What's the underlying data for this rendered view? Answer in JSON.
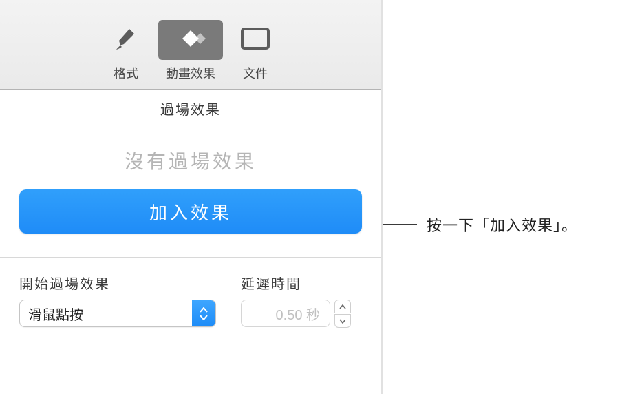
{
  "toolbar": {
    "format": "格式",
    "animate": "動畫效果",
    "document": "文件"
  },
  "section": {
    "title": "過場效果",
    "no_effect": "沒有過場效果",
    "add_button": "加入效果"
  },
  "controls": {
    "start_label": "開始過場效果",
    "start_value": "滑鼠點按",
    "delay_label": "延遲時間",
    "delay_value": "0.50 秒"
  },
  "callout": {
    "text": "按一下「加入效果」。"
  }
}
